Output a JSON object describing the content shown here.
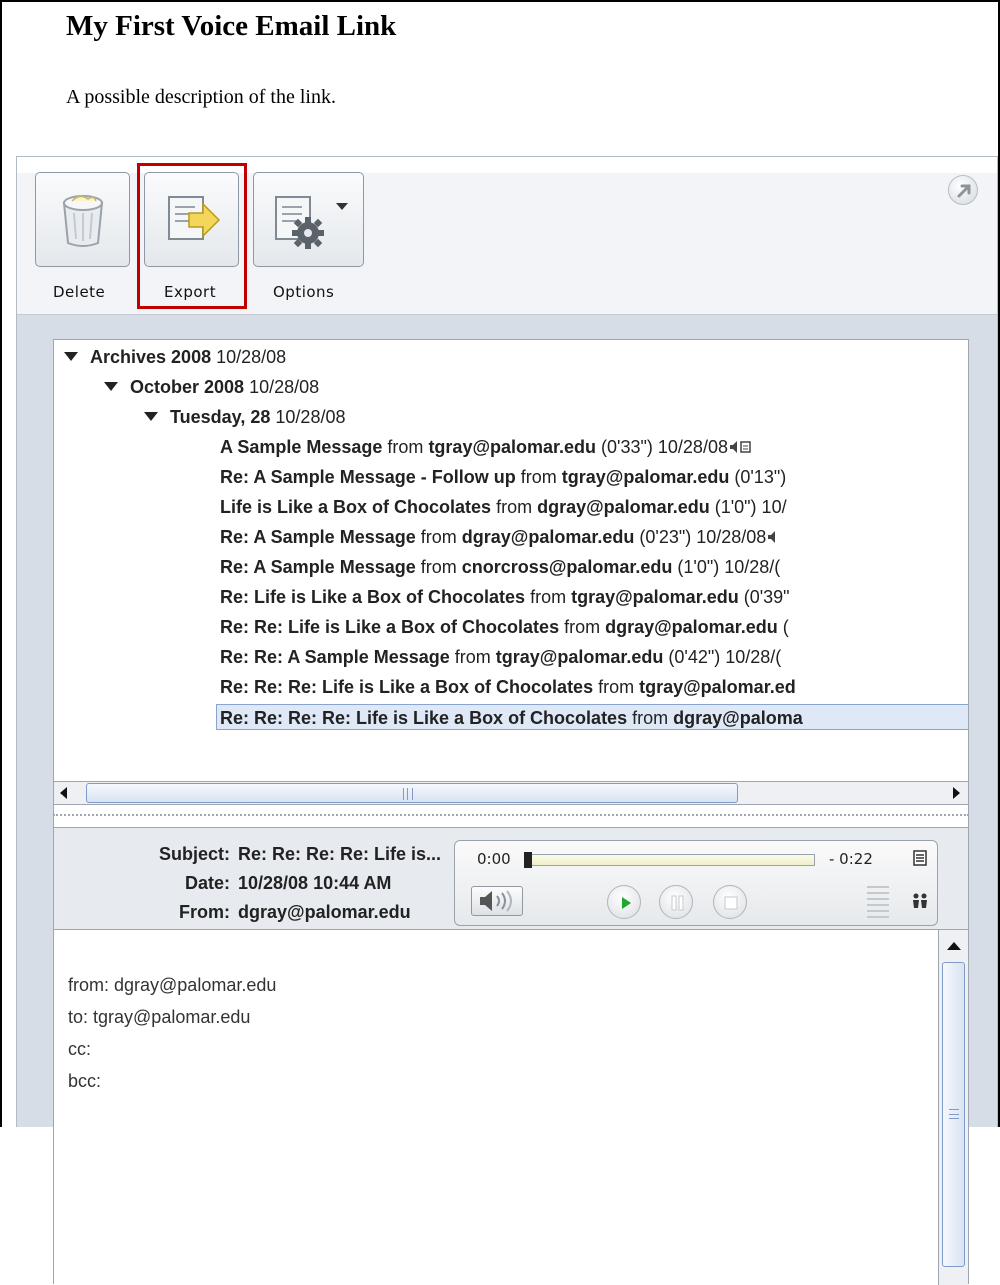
{
  "page": {
    "title": "My First Voice Email Link",
    "description": "A possible description of the link."
  },
  "toolbar": {
    "delete_label": "Delete",
    "export_label": "Export",
    "options_label": "Options",
    "highlight_color": "#c00000"
  },
  "tree": {
    "year": {
      "name": "Archives 2008",
      "date": "10/28/08"
    },
    "month": {
      "name": "October 2008",
      "date": "10/28/08"
    },
    "day": {
      "name": "Tuesday, 28",
      "date": "10/28/08"
    },
    "messages": [
      {
        "subject": "A Sample Message",
        "from": "tgray@palomar.edu",
        "tail": " (0'33\") 10/28/08"
      },
      {
        "subject": "Re: A Sample Message - Follow up",
        "from": "tgray@palomar.edu",
        "tail": " (0'13\")"
      },
      {
        "subject": "Life is Like a Box of Chocolates",
        "from": "dgray@palomar.edu",
        "tail": " (1'0\") 10/"
      },
      {
        "subject": "Re: A Sample Message",
        "from": "dgray@palomar.edu",
        "tail": " (0'23\") 10/28/08"
      },
      {
        "subject": "Re: A Sample Message",
        "from": "cnorcross@palomar.edu",
        "tail": " (1'0\") 10/28/("
      },
      {
        "subject": "Re: Life is Like a Box of Chocolates",
        "from": "tgray@palomar.edu",
        "tail": " (0'39\""
      },
      {
        "subject": "Re: Re: Life is Like a Box of Chocolates",
        "from": "dgray@palomar.edu",
        "tail": " ("
      },
      {
        "subject": "Re: Re: A Sample Message",
        "from": "tgray@palomar.edu",
        "tail": " (0'42\") 10/28/("
      },
      {
        "subject": "Re: Re: Re: Life is Like a Box of Chocolates",
        "from": "tgray@palomar.ed",
        "tail": ""
      },
      {
        "subject": "Re: Re: Re: Re: Life is Like a Box of Chocolates",
        "from": "dgray@paloma",
        "tail": ""
      }
    ],
    "from_word": "from",
    "selected_index": 9
  },
  "detail": {
    "subject_label": "Subject:",
    "subject_value": "Re: Re: Re: Re: Life is...",
    "date_label": "Date:",
    "date_value": "10/28/08 10:44 AM",
    "from_label": "From:",
    "from_value": "dgray@palomar.edu"
  },
  "player": {
    "current_time": "0:00",
    "remaining_time": "- 0:22",
    "progress": 0.0
  },
  "body": {
    "lines": [
      "from: dgray@palomar.edu",
      "to: tgray@palomar.edu",
      "cc:",
      "bcc:"
    ]
  },
  "icons": {
    "delete": "trash-can-icon",
    "export": "export-arrow-icon",
    "options": "gear-icon",
    "corner": "external-link-icon"
  }
}
